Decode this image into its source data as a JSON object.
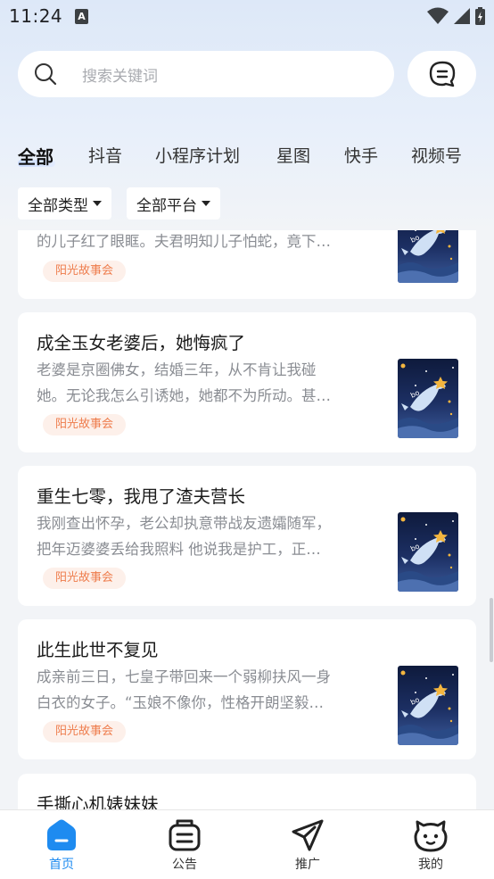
{
  "status_bar": {
    "time": "11:24"
  },
  "search": {
    "placeholder": "搜索关键词"
  },
  "tabs": [
    {
      "label": "全部",
      "active": true
    },
    {
      "label": "抖音"
    },
    {
      "label": "小程序计划"
    },
    {
      "label": "星图"
    },
    {
      "label": "快手"
    },
    {
      "label": "视频号"
    }
  ],
  "filters": {
    "type_label": "全部类型",
    "platform_label": "全部平台"
  },
  "cards": [
    {
      "title": "",
      "desc_lines": [
        "的儿子红了眼眶。夫君明知儿子怕蛇，竟下…"
      ],
      "tag": "阳光故事会"
    },
    {
      "title": "成全玉女老婆后，她悔疯了",
      "desc_lines": [
        "老婆是京圈佛女，结婚三年，从不肯让我碰",
        "她。无论我怎么引诱她，她都不为所动。甚…"
      ],
      "tag": "阳光故事会"
    },
    {
      "title": "重生七零，我甩了渣夫营长",
      "desc_lines": [
        "我刚查出怀孕，老公却执意带战友遗孀随军，",
        "把年迈婆婆丢给我照料 他说我是护工，正…"
      ],
      "tag": "阳光故事会"
    },
    {
      "title": "此生此世不复见",
      "desc_lines": [
        "成亲前三日，七皇子带回来一个弱柳扶风一身",
        "白衣的女子。“玉娘不像你，性格开朗坚毅…"
      ],
      "tag": "阳光故事会"
    },
    {
      "title": "手撕心机婊妹妹",
      "desc_lines": [],
      "tag": ""
    }
  ],
  "bottom_nav": [
    {
      "label": "首页",
      "icon": "home-icon",
      "active": true
    },
    {
      "label": "公告",
      "icon": "notice-icon"
    },
    {
      "label": "推广",
      "icon": "promote-icon"
    },
    {
      "label": "我的",
      "icon": "profile-icon"
    }
  ],
  "colors": {
    "accent": "#1e8bf0",
    "tag_text": "#ee7d4d",
    "tag_bg": "#fdf0ea"
  }
}
